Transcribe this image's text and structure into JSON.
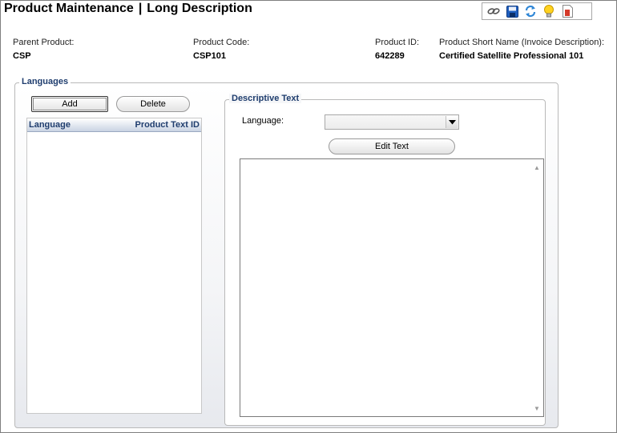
{
  "header": {
    "title_left": "Product Maintenance",
    "title_separator": "|",
    "title_right": "Long Description"
  },
  "toolbar": {
    "icons": [
      "link-icon",
      "save-icon",
      "refresh-icon",
      "lightbulb-icon",
      "report-icon"
    ]
  },
  "product_info": {
    "parent_product_label": "Parent Product:",
    "parent_product_value": "CSP",
    "product_code_label": "Product Code:",
    "product_code_value": "CSP101",
    "product_id_label": "Product ID:",
    "product_id_value": "642289",
    "short_name_label": "Product Short Name (Invoice Description):",
    "short_name_value": "Certified Satellite Professional 101"
  },
  "languages": {
    "group_title": "Languages",
    "add_label": "Add",
    "delete_label": "Delete",
    "columns": [
      "Language",
      "Product Text ID"
    ],
    "rows": []
  },
  "descriptive_text": {
    "group_title": "Descriptive Text",
    "language_label": "Language:",
    "language_value": "",
    "edit_text_label": "Edit Text",
    "text_value": ""
  }
}
